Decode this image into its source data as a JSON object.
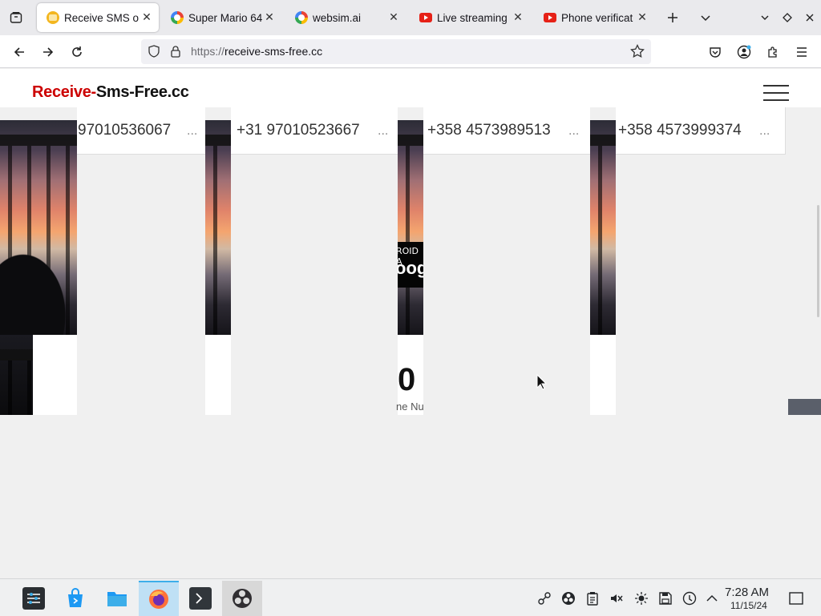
{
  "browser": {
    "tabs": [
      {
        "title": "Receive SMS o",
        "favicon": "sms-smiley-favicon",
        "active": true
      },
      {
        "title": "Super Mario 64",
        "favicon": "google-chrome-favicon",
        "active": false
      },
      {
        "title": "websim.ai",
        "favicon": "google-chrome-favicon",
        "active": false
      },
      {
        "title": "Live streaming",
        "favicon": "youtube-favicon",
        "active": false
      },
      {
        "title": "Phone verificat",
        "favicon": "youtube-favicon",
        "active": false
      }
    ],
    "url_scheme": "https://",
    "url_host": "receive-sms-free.cc"
  },
  "site": {
    "logo_part1": "Receive-",
    "logo_part2": "Sms-Free.cc",
    "numbers": [
      {
        "text": "97010536067",
        "more": "..."
      },
      {
        "text": "+31 97010523667",
        "more": "..."
      },
      {
        "text": "+358 4573989513",
        "more": "..."
      },
      {
        "text": "+358 4573999374",
        "more": "..."
      }
    ],
    "ad_small": "ROID A",
    "ad_big": "oog",
    "big_zero": "0",
    "cut_text": "ne Nu"
  },
  "taskbar": {
    "apps": [
      "settings-app",
      "store-app",
      "file-manager-app",
      "firefox-app",
      "terminal-app",
      "obs-app"
    ],
    "time": "7:28 AM",
    "date": "11/15/24"
  },
  "colors": {
    "logo_red": "#cc0000",
    "accent": "#3daee9"
  }
}
